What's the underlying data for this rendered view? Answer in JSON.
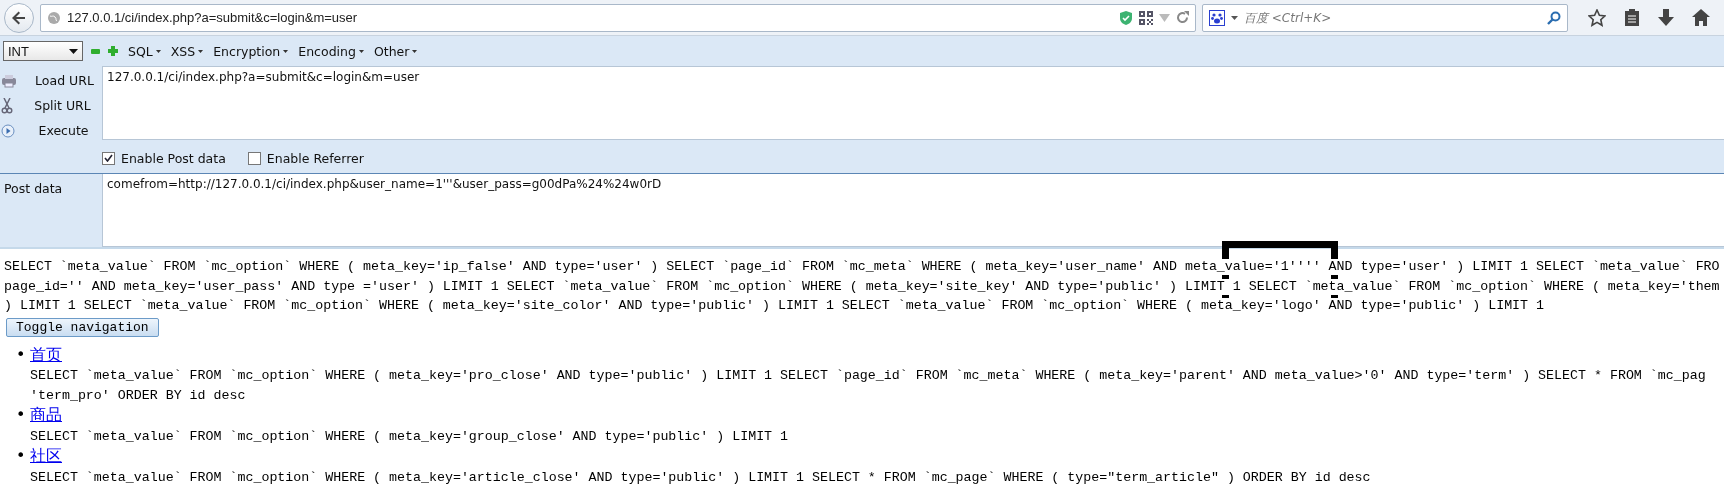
{
  "browser": {
    "url": "127.0.0.1/ci/index.php?a=submit&c=login&m=user",
    "search_placeholder": "百度 <Ctrl+K>"
  },
  "hackbar": {
    "select": "INT",
    "menus": [
      "SQL",
      "XSS",
      "Encryption",
      "Encoding",
      "Other"
    ],
    "actions": [
      {
        "kind": "load",
        "label": "Load URL"
      },
      {
        "kind": "split",
        "label": "Split URL"
      },
      {
        "kind": "execute",
        "label": "Execute"
      }
    ],
    "url_value": "127.0.0.1/ci/index.php?a=submit&c=login&m=user",
    "options": [
      {
        "label": "Enable Post data",
        "checked": true
      },
      {
        "label": "Enable Referrer",
        "checked": false
      }
    ],
    "post_label": "Post data",
    "post_value": "comefrom=http://127.0.0.1/ci/index.php&user_name=1'''&user_pass=g00dPa%24%24w0rD"
  },
  "page": {
    "sql_lines": [
      "SELECT `meta_value` FROM `mc_option` WHERE ( meta_key='ip_false' AND type='user' ) SELECT `page_id` FROM `mc_meta` WHERE ( meta_key='user_name' AND meta_value='1'''' AND type='user' ) LIMIT 1 SELECT `meta_value` FRO",
      "page_id='' AND meta_key='user_pass' AND type ='user' ) LIMIT 1 SELECT `meta_value` FROM `mc_option` WHERE ( meta_key='site_key' AND type='public' ) LIMIT 1 SELECT `meta_value` FROM `mc_option` WHERE ( meta_key='them",
      ") LIMIT 1 SELECT `meta_value` FROM `mc_option` WHERE ( meta_key='site_color' AND type='public' ) LIMIT 1 SELECT `meta_value` FROM `mc_option` WHERE ( meta_key='logo' AND type='public' ) LIMIT 1"
    ],
    "toggle_button": "Toggle navigation",
    "nav": [
      {
        "marker": "•",
        "label": "首页",
        "sql_lines": [
          "SELECT `meta_value` FROM `mc_option` WHERE ( meta_key='pro_close' AND type='public' ) LIMIT 1 SELECT `page_id` FROM `mc_meta` WHERE ( meta_key='parent' AND meta_value>'0' AND type='term' ) SELECT * FROM `mc_pag",
          "'term_pro' ORDER BY id desc"
        ]
      },
      {
        "marker": "•",
        "label": "商品",
        "sql_lines": [
          "SELECT `meta_value` FROM `mc_option` WHERE ( meta_key='group_close' AND type='public' ) LIMIT 1"
        ]
      },
      {
        "marker": "•",
        "label": "社区",
        "sql_lines": [
          "SELECT `meta_value` FROM `mc_option` WHERE ( meta_key='article_close' AND type='public' ) LIMIT 1 SELECT * FROM `mc_page` WHERE ( type=\"term_article\" ) ORDER BY id desc"
        ]
      }
    ]
  }
}
